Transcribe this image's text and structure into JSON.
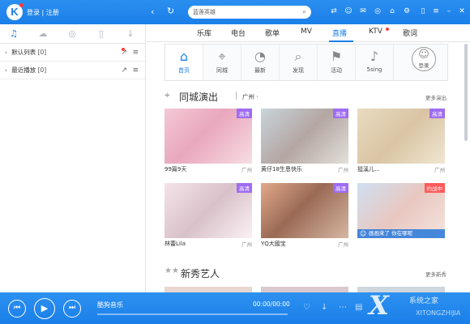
{
  "colors": {
    "accent": "#1a7fe8",
    "hd_badge": "#9e6cf2",
    "live_badge": "#ff5a5a"
  },
  "topbar": {
    "auth": "登录 | 注册",
    "search_placeholder": "蓝莲英雄"
  },
  "sidebar": {
    "tabs": [
      "music-note-icon",
      "cloud-icon",
      "radio-icon",
      "phone-icon",
      "download-icon"
    ],
    "playlists": [
      {
        "name": "默认列表",
        "count": "[0]"
      },
      {
        "name": "最近播放",
        "count": "[0]"
      }
    ]
  },
  "main": {
    "tabs": [
      {
        "label": "乐库"
      },
      {
        "label": "电台"
      },
      {
        "label": "歌单"
      },
      {
        "label": "MV"
      },
      {
        "label": "直播"
      },
      {
        "label": "KTV"
      },
      {
        "label": "歌词"
      }
    ],
    "subnav": [
      {
        "label": "首页",
        "icon": "home-icon"
      },
      {
        "label": "同城",
        "icon": "location-icon"
      },
      {
        "label": "最新",
        "icon": "clock-icon"
      },
      {
        "label": "发现",
        "icon": "search-icon"
      },
      {
        "label": "活动",
        "icon": "flag-icon"
      },
      {
        "label": "5sing",
        "icon": "guitar-icon"
      }
    ],
    "login_label": "登录",
    "section1": {
      "title": "同城演出",
      "city": "广州 ·",
      "more": "更多演出"
    },
    "cards": [
      {
        "caption": "99篇9天",
        "loc": "广州",
        "badge": "高清"
      },
      {
        "caption": "黄仔18生恩快乐",
        "loc": "广州",
        "badge": "高清"
      },
      {
        "caption": "挺溪儿...",
        "loc": "广州",
        "badge": "高清"
      },
      {
        "caption": "林蕾Lila",
        "loc": "广州",
        "badge": "高清"
      },
      {
        "caption": "YQ大國宝",
        "loc": "广州",
        "badge": "高清"
      },
      {
        "caption": "",
        "loc": "",
        "badge": "约战中",
        "footer": "画画来了 你在哪呢"
      }
    ],
    "section2": {
      "title": "新秀艺人",
      "more": "更多新秀"
    }
  },
  "player": {
    "title": "酷狗音乐",
    "time": "00:00/00:00"
  },
  "watermark": {
    "brand": "X",
    "t1": "系统之家",
    "t2": "XITONGZHIJIA"
  }
}
